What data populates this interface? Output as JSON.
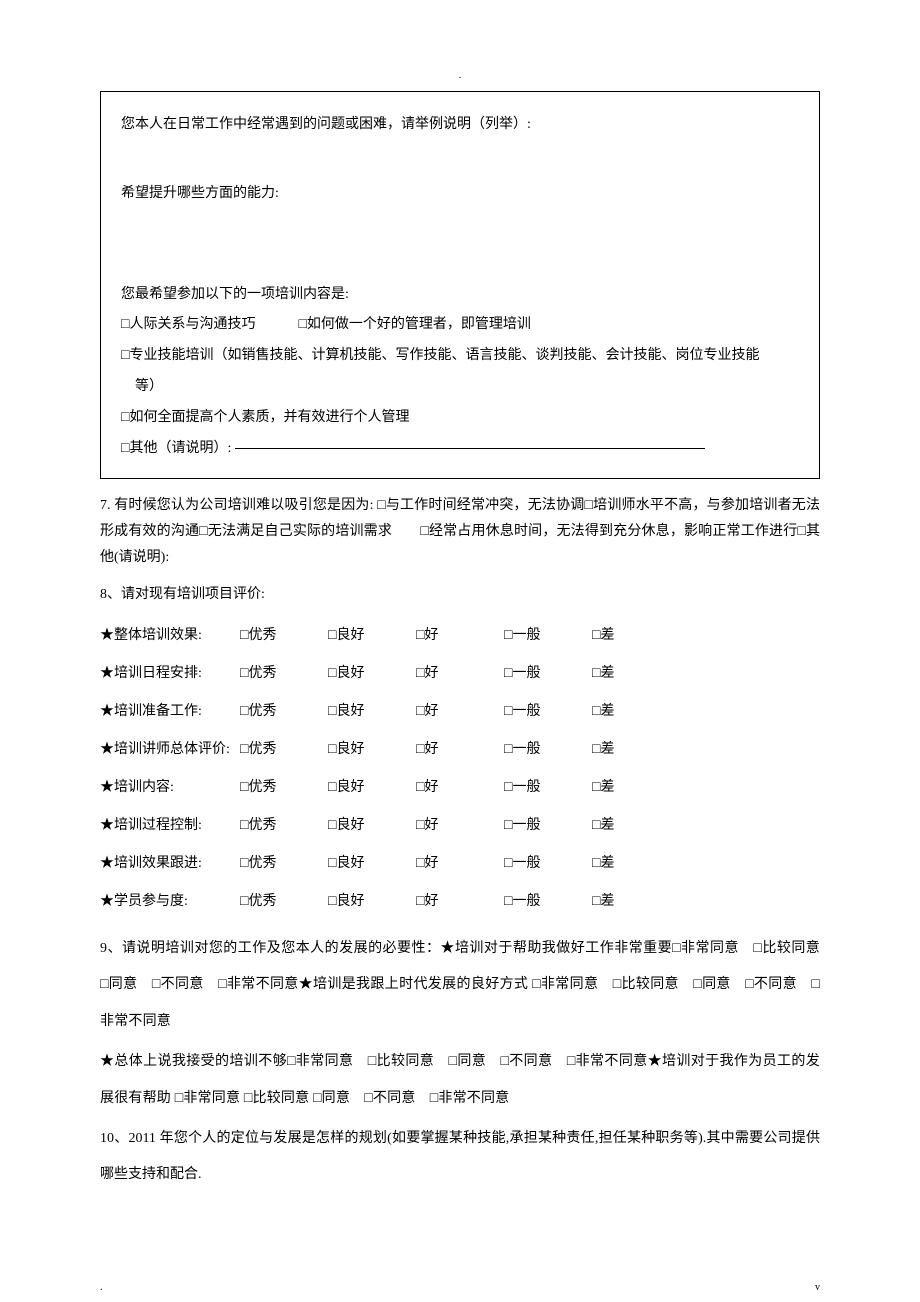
{
  "header": {
    "dot": "."
  },
  "box": {
    "l1": "您本人在日常工作中经常遇到的问题或困难，请举例说明（列举）:",
    "l2": "希望提升哪些方面的能力:",
    "l3": "您最希望参加以下的一项培训内容是:",
    "opt1a": "□人际关系与沟通技巧",
    "opt1b": "□如何做一个好的管理者，即管理培训",
    "opt2": "□专业技能培训（如销售技能、计算机技能、写作技能、语言技能、谈判技能、会计技能、岗位专业技能",
    "opt2b": "等）",
    "opt3": "□如何全面提高个人素质，并有效进行个人管理",
    "opt4": "□其他（请说明）:"
  },
  "q7": "7. 有时候您认为公司培训难以吸引您是因为: □与工作时间经常冲突，无法协调□培训师水平不高，与参加培训者无法形成有效的沟通□无法满足自己实际的培训需求　　□经常占用休息时间，无法得到充分休息，影响正常工作进行□其他(请说明):",
  "q8": {
    "title": "8、请对现有培训项目评价:",
    "rows": [
      "★整体培训效果:",
      "★培训日程安排:",
      "★培训准备工作:",
      "★培训讲师总体评价:",
      "★培训内容:",
      "★培训过程控制:",
      "★培训效果跟进:",
      "★学员参与度:"
    ],
    "opts": [
      "□优秀",
      "□良好",
      "□好",
      "□一般",
      "□差"
    ]
  },
  "q9": {
    "p1": "9、请说明培训对您的工作及您本人的发展的必要性：★培训对于帮助我做好工作非常重要□非常同意　□比较同意　□同意　□不同意　□非常不同意★培训是我跟上时代发展的良好方式 □非常同意　□比较同意　□同意　□不同意　□非常不同意",
    "p2": "★总体上说我接受的培训不够□非常同意　□比较同意　□同意　□不同意　□非常不同意★培训对于我作为员工的发展很有帮助 □非常同意 □比较同意 □同意　□不同意　□非常不同意"
  },
  "q10": "10、2011 年您个人的定位与发展是怎样的规划(如要掌握某种技能,承担某种责任,担任某种职务等).其中需要公司提供哪些支持和配合.",
  "footer": {
    "left": ".",
    "right": "v"
  }
}
